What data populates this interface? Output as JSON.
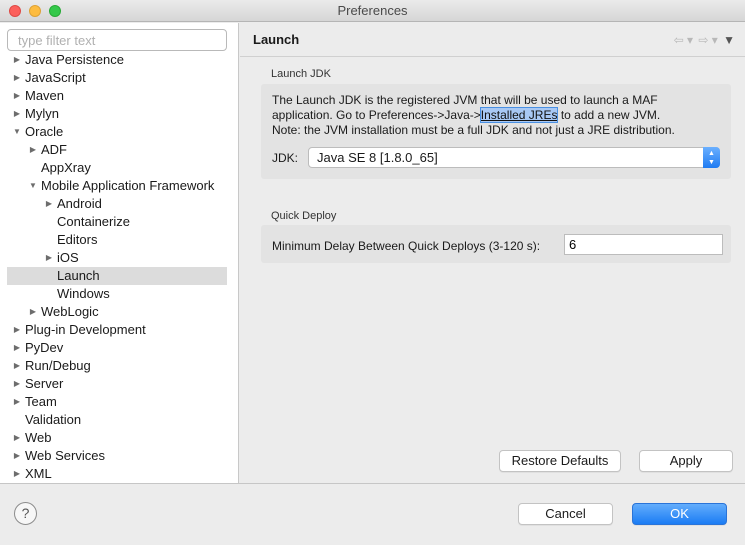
{
  "window": {
    "title": "Preferences"
  },
  "filter": {
    "placeholder": "type filter text"
  },
  "tree": [
    {
      "label": "Java Persistence",
      "twisty": "▶",
      "indent": 0
    },
    {
      "label": "JavaScript",
      "twisty": "▶",
      "indent": 0
    },
    {
      "label": "Maven",
      "twisty": "▶",
      "indent": 0
    },
    {
      "label": "Mylyn",
      "twisty": "▶",
      "indent": 0
    },
    {
      "label": "Oracle",
      "twisty": "▼",
      "indent": 0
    },
    {
      "label": "ADF",
      "twisty": "▶",
      "indent": 1
    },
    {
      "label": "AppXray",
      "twisty": "",
      "indent": 1
    },
    {
      "label": "Mobile Application Framework",
      "twisty": "▼",
      "indent": 1
    },
    {
      "label": "Android",
      "twisty": "▶",
      "indent": 2
    },
    {
      "label": "Containerize",
      "twisty": "",
      "indent": 2
    },
    {
      "label": "Editors",
      "twisty": "",
      "indent": 2
    },
    {
      "label": "iOS",
      "twisty": "▶",
      "indent": 2
    },
    {
      "label": "Launch",
      "twisty": "",
      "indent": 2,
      "selected": true
    },
    {
      "label": "Windows",
      "twisty": "",
      "indent": 2
    },
    {
      "label": "WebLogic",
      "twisty": "▶",
      "indent": 1
    },
    {
      "label": "Plug-in Development",
      "twisty": "▶",
      "indent": 0
    },
    {
      "label": "PyDev",
      "twisty": "▶",
      "indent": 0
    },
    {
      "label": "Run/Debug",
      "twisty": "▶",
      "indent": 0
    },
    {
      "label": "Server",
      "twisty": "▶",
      "indent": 0
    },
    {
      "label": "Team",
      "twisty": "▶",
      "indent": 0
    },
    {
      "label": "Validation",
      "twisty": "",
      "indent": 0
    },
    {
      "label": "Web",
      "twisty": "▶",
      "indent": 0
    },
    {
      "label": "Web Services",
      "twisty": "▶",
      "indent": 0
    },
    {
      "label": "XML",
      "twisty": "▶",
      "indent": 0
    }
  ],
  "page": {
    "title": "Launch",
    "nav_back": "⇦ ▾",
    "nav_forward": "⇨ ▾",
    "nav_menu": "▼"
  },
  "launch_jdk": {
    "group_title": "Launch JDK",
    "desc_line1": "The Launch JDK is the registered JVM that will be used to launch a MAF",
    "desc_line2_pre": "application.  Go to Preferences->Java->",
    "desc_link": "Installed JREs",
    "desc_line2_post": " to add a new JVM.",
    "desc_line3": "Note: the JVM installation must be a full JDK and not just a JRE distribution.",
    "jdk_label": "JDK:",
    "jdk_value": "Java SE 8 [1.8.0_65]"
  },
  "quick_deploy": {
    "group_title": "Quick Deploy",
    "delay_label": "Minimum Delay Between Quick Deploys (3-120 s):",
    "delay_value": "6"
  },
  "buttons": {
    "restore_defaults": "Restore Defaults",
    "apply": "Apply",
    "cancel": "Cancel",
    "ok": "OK",
    "help": "?"
  }
}
